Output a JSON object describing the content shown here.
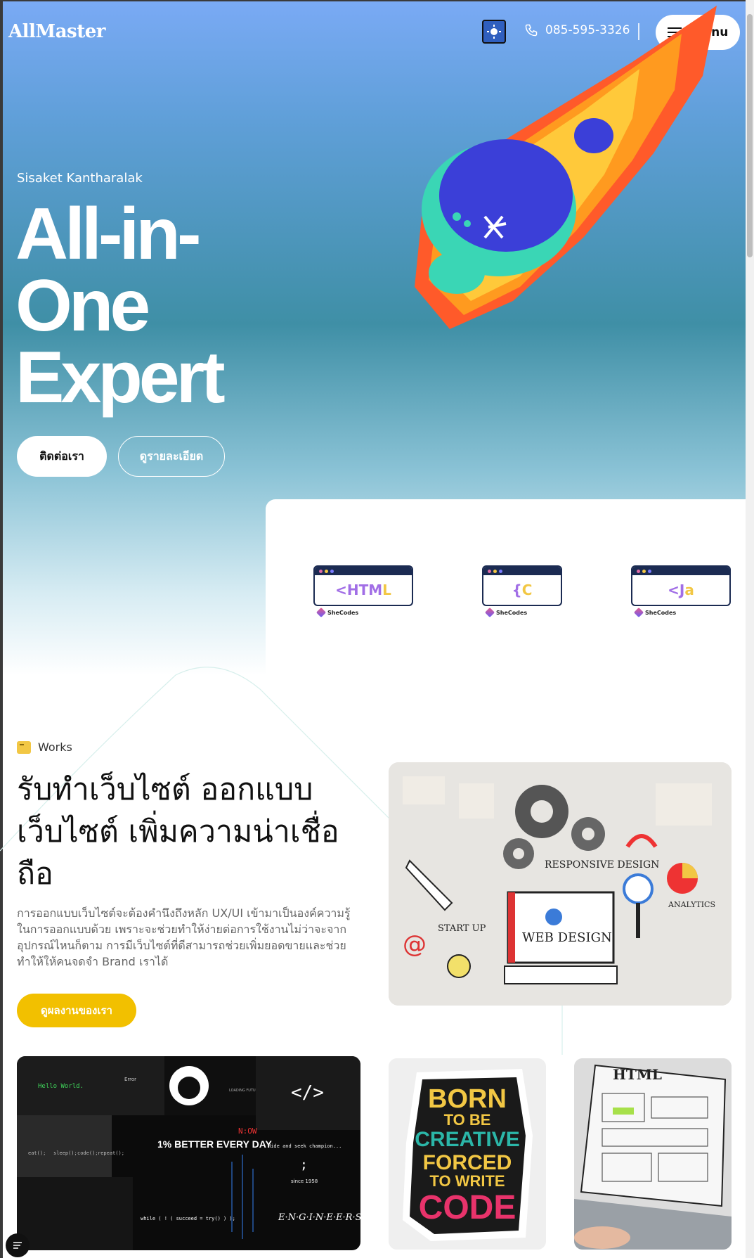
{
  "header": {
    "logo": "AllMaster",
    "phone": "085-595-3326",
    "menu_label": "Menu",
    "theme_icon": "sun-icon"
  },
  "hero": {
    "subtitle": "Sisaket Kantharalak",
    "title_line1": "All-in-",
    "title_line2": "One",
    "title_line3": "Expert",
    "btn_contact": "ติดต่อเรา",
    "btn_detail": "ดูรายละเอียด"
  },
  "tech_cards": [
    {
      "code_main": "<HTM",
      "code_tail": "L",
      "brand": "SheCodes"
    },
    {
      "code_main": "{",
      "code_tail": "C",
      "brand": "SheCodes"
    },
    {
      "code_main": "<J",
      "code_tail": "a",
      "brand": "SheCodes"
    }
  ],
  "works": {
    "tag": "Works",
    "title": "รับทำเว็บไซต์ ออกแบบเว็บไซต์ เพิ่มความน่าเชื่อถือ",
    "description": "การออกแบบเว็บไซต์จะต้องคำนึงถึงหลัก UX/UI เข้ามาเป็นองค์ความรู้ในการออกแบบด้วย เพราะจะช่วยทำให้ง่ายต่อการใช้งานไม่ว่าจะจากอุปกรณ์ไหนก็ตาม การมีเว็บไซต์ที่ดีสามารถช่วยเพิ่มยอดขายและช่วยทำให้ให้คนจดจำ Brand เราได้",
    "button": "ดูผลงานของเรา"
  },
  "web_design_image": {
    "label_responsive": "RESPONSIVE DESIGN",
    "label_startup": "START UP",
    "label_web": "WEB DESIGN",
    "label_analytics": "ANALYTICS"
  },
  "collage": {
    "hello": "Hello World.",
    "error": "Error",
    "loading": "LOADING FUTURE",
    "better": "1% BETTER EVERY DAY",
    "now": "N:OW",
    "seek": "Hide and seek champion...",
    "semicolon": ";",
    "since": "since 1958",
    "loop": "while ( ! ( succeed = try() ) );",
    "engineers": "E·N·G·I·N·E·E·R·S",
    "eat": "eat();",
    "sleep": "sleep();",
    "code": "code();",
    "repeat": "repeat();"
  },
  "sticker": {
    "line1": "BORN",
    "line2": "TO BE",
    "line3": "CREATIVE",
    "line4": "FORCED",
    "line5": "TO WRITE",
    "line6": "CODE"
  },
  "laptop": {
    "label": "HTML"
  },
  "colors": {
    "accent_yellow": "#f2c000",
    "navy": "#1b2b52",
    "purple": "#a16ee6"
  }
}
